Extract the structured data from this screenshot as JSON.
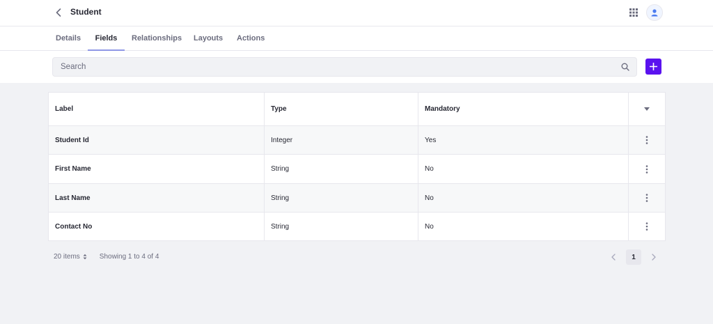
{
  "header": {
    "title": "Student",
    "back_icon": "chevron-left-icon",
    "apps_icon": "grid-icon",
    "avatar_icon": "user-icon"
  },
  "tabs": [
    {
      "label": "Details",
      "active": false
    },
    {
      "label": "Fields",
      "active": true
    },
    {
      "label": "Relationships",
      "active": false
    },
    {
      "label": "Layouts",
      "active": false
    },
    {
      "label": "Actions",
      "active": false
    }
  ],
  "search": {
    "placeholder": "Search",
    "value": ""
  },
  "colors": {
    "accent": "#5a12ef",
    "tab_indicator": "#8f97e6"
  },
  "table": {
    "columns": [
      "Label",
      "Type",
      "Mandatory"
    ],
    "rows": [
      {
        "label": "Student Id",
        "type": "Integer",
        "mandatory": "Yes"
      },
      {
        "label": "First Name",
        "type": "String",
        "mandatory": "No"
      },
      {
        "label": "Last Name",
        "type": "String",
        "mandatory": "No"
      },
      {
        "label": "Contact No",
        "type": "String",
        "mandatory": "No"
      }
    ]
  },
  "footer": {
    "items_per_page": "20 items",
    "showing": "Showing 1 to 4 of 4",
    "current_page": "1"
  }
}
